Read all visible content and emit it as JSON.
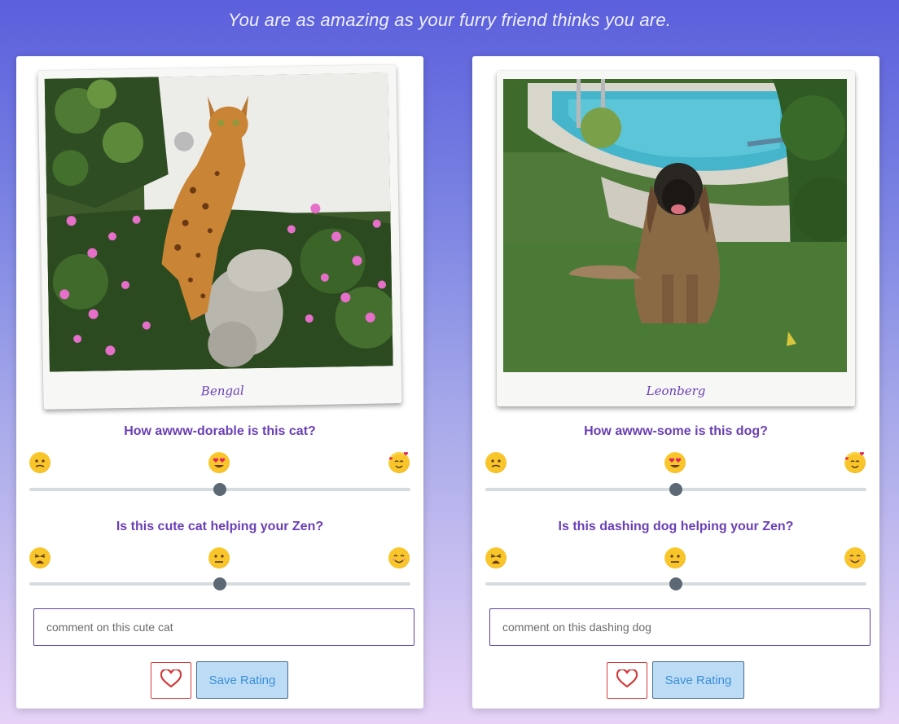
{
  "header": {
    "tagline": "You are as amazing as your furry friend thinks you are."
  },
  "cards": [
    {
      "pet_caption": "Bengal",
      "question_1": "How awww-dorable is this cat?",
      "question_2": "Is this cute cat helping your Zen?",
      "rating_1": 0.5,
      "rating_2": 0.5,
      "comment_placeholder": "comment on this cute cat",
      "save_label": "Save Rating"
    },
    {
      "pet_caption": "Leonberg",
      "question_1": "How awww-some is this dog?",
      "question_2": "Is this dashing dog helping your Zen?",
      "rating_1": 0.5,
      "rating_2": 0.5,
      "comment_placeholder": "comment on this dashing dog",
      "save_label": "Save Rating"
    }
  ],
  "scale_1_icons": [
    "confused-face-icon",
    "heart-eyes-face-icon",
    "smiling-face-with-hearts-icon"
  ],
  "scale_2_icons": [
    "weary-face-icon",
    "neutral-face-icon",
    "smiling-face-icon"
  ],
  "colors": {
    "accent": "#6a3fb5",
    "heart": "#d43b3b",
    "save_bg": "#bcdcf5",
    "save_text": "#3b8edb"
  }
}
